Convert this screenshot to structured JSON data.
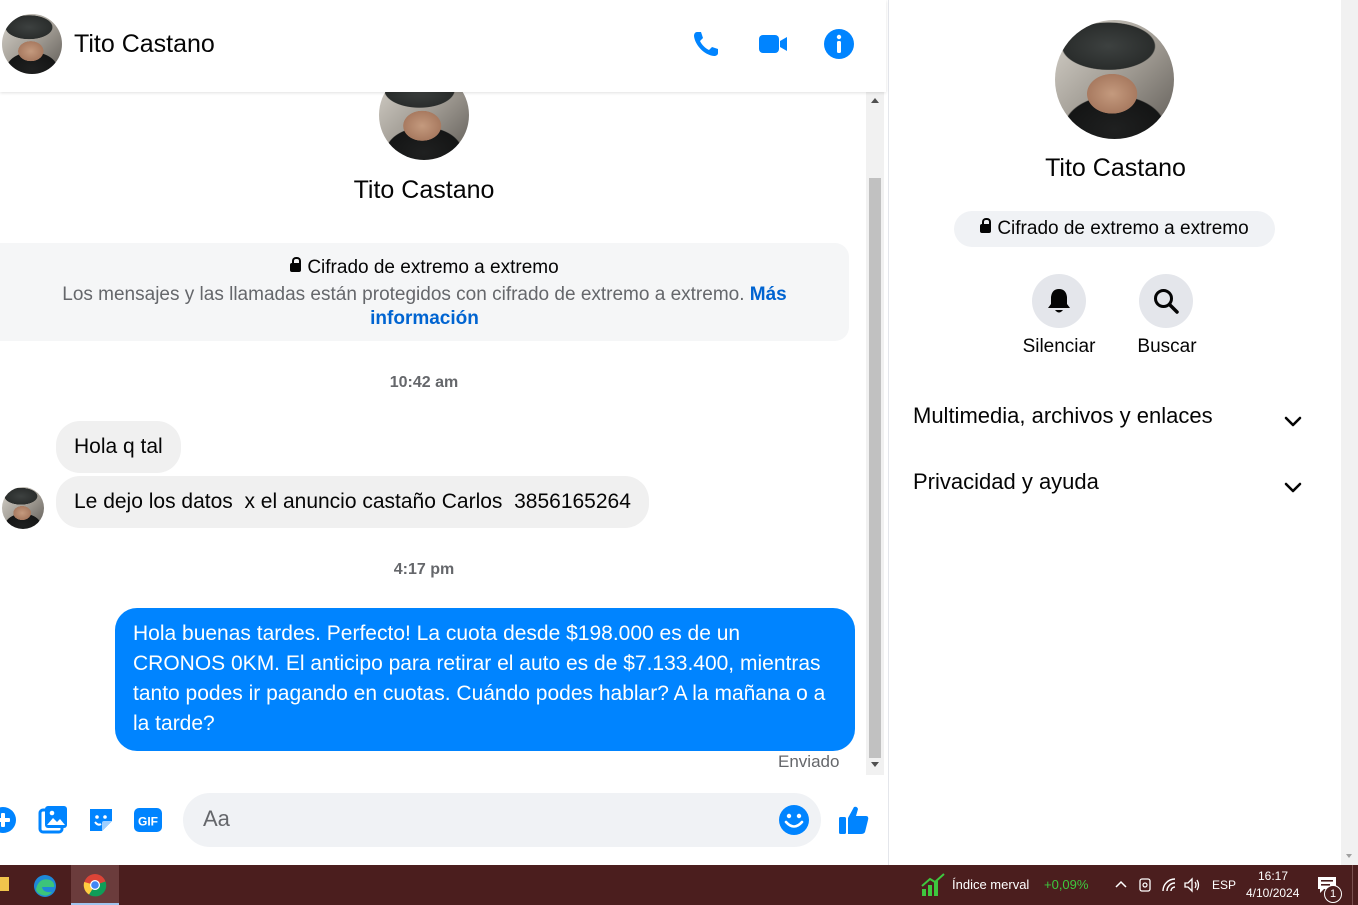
{
  "chat": {
    "contact_name": "Tito Castano",
    "e2e_title": "Cifrado de extremo a extremo",
    "e2e_description": "Los mensajes y las llamadas están protegidos con cifrado de extremo a extremo.",
    "e2e_link": "Más información",
    "timestamps": [
      "10:42 am",
      "4:17 pm"
    ],
    "incoming": [
      "Hola q tal",
      "Le dejo los datos  x el anuncio castaño Carlos  3856165264"
    ],
    "outgoing": "Hola buenas tardes. Perfecto! La cuota desde $198.000 es de un CRONOS 0KM. El anticipo para retirar el auto es de $7.133.400, mientras tanto podes ir pagando en cuotas. Cuándo podes hablar? A la mañana o a la tarde?",
    "sent_status": "Enviado",
    "input_placeholder": "Aa"
  },
  "header_icons": [
    "phone-icon",
    "video-icon",
    "info-icon"
  ],
  "composer_icons": [
    "plus-icon",
    "image-icon",
    "sticker-icon",
    "gif-icon",
    "emoji-icon",
    "like-icon"
  ],
  "gif_label": "GIF",
  "panel": {
    "name": "Tito Castano",
    "e2e_pill": "Cifrado de extremo a extremo",
    "actions": [
      {
        "label": "Silenciar",
        "icon": "bell-icon"
      },
      {
        "label": "Buscar",
        "icon": "search-icon"
      }
    ],
    "sections": [
      "Multimedia, archivos y enlaces",
      "Privacidad y ayuda"
    ]
  },
  "taskbar": {
    "widget_label": "Índice merval",
    "widget_value": "+0,09%",
    "language": "ESP",
    "time": "16:17",
    "date": "4/10/2024",
    "notification_count": "1"
  },
  "colors": {
    "messenger_blue": "#0084ff",
    "link_blue": "#0064d1",
    "taskbar": "#4b1e1e",
    "merval_green": "#3ec73e"
  }
}
